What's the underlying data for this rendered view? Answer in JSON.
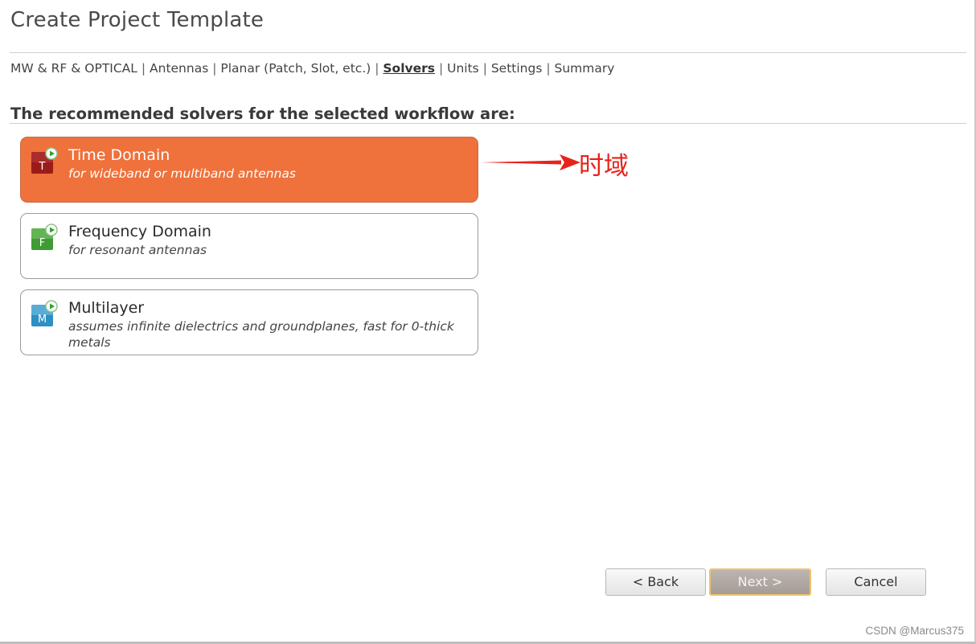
{
  "window": {
    "title": "Create Project Template"
  },
  "breadcrumb": {
    "items": [
      "MW & RF & OPTICAL",
      "Antennas",
      "Planar (Patch, Slot, etc.)",
      "Solvers",
      "Units",
      "Settings",
      "Summary"
    ],
    "separator": "|",
    "active": "Solvers"
  },
  "heading": "The recommended solvers for the selected workflow are:",
  "solvers": [
    {
      "letter": "T",
      "name": "Time Domain",
      "description": "for wideband or multiband antennas",
      "icon": "time-domain-solver-icon",
      "color": "#9b1b1b",
      "selected": true
    },
    {
      "letter": "F",
      "name": "Frequency Domain",
      "description": "for resonant antennas",
      "icon": "frequency-domain-solver-icon",
      "color": "#3f9b34",
      "selected": false
    },
    {
      "letter": "M",
      "name": "Multilayer",
      "description": "assumes infinite dielectrics and groundplanes, fast for 0-thick metals",
      "icon": "multilayer-solver-icon",
      "color": "#2d8fc2",
      "selected": false
    }
  ],
  "annotation": {
    "text": "时域",
    "color": "#e8231b"
  },
  "buttons": {
    "back": "< Back",
    "next": "Next >",
    "cancel": "Cancel"
  },
  "watermark": "CSDN @Marcus375",
  "colors": {
    "selected_bg": "#ef713b",
    "next_border": "#f0c36a"
  }
}
